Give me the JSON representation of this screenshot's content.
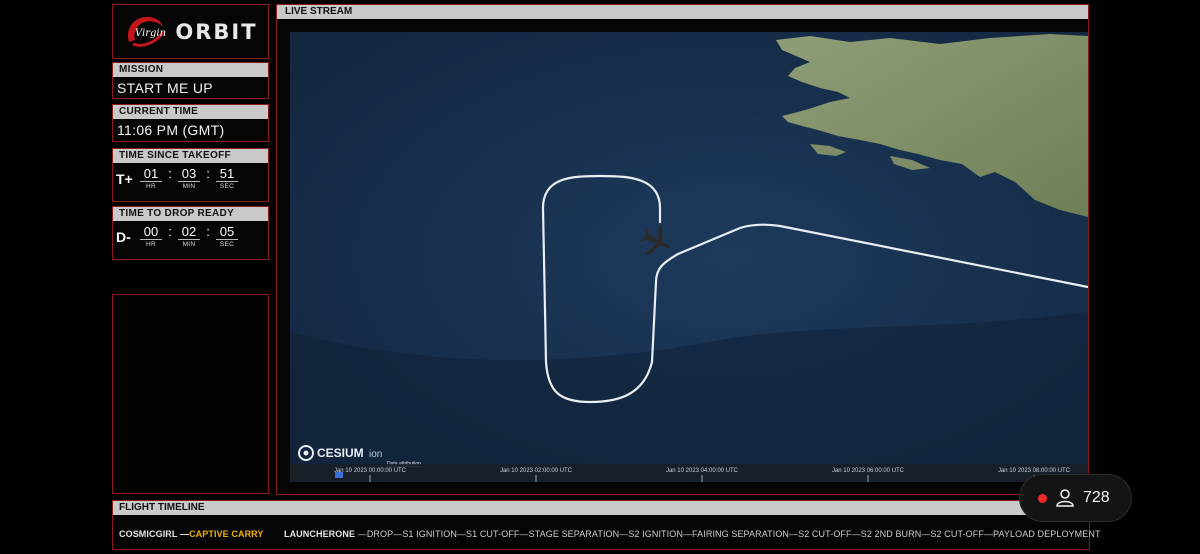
{
  "brand": {
    "logo_script": "Virgin",
    "logo_text": "ORBIT",
    "accent": "#c4161c"
  },
  "mission": {
    "label": "MISSION",
    "value": "START ME UP"
  },
  "current_time": {
    "label": "CURRENT TIME",
    "value": "11:06 PM (GMT)"
  },
  "time_since_takeoff": {
    "label": "TIME SINCE TAKEOFF",
    "prefix": "T+",
    "hr": "01",
    "min": "03",
    "sec": "51",
    "hr_label": "HR",
    "min_label": "MIN",
    "sec_label": "SEC"
  },
  "time_to_drop": {
    "label": "TIME TO DROP READY",
    "prefix": "D-",
    "hr": "00",
    "min": "02",
    "sec": "05",
    "hr_label": "HR",
    "min_label": "MIN",
    "sec_label": "SEC"
  },
  "live_stream": {
    "label": "LIVE STREAM",
    "attribution_logo": "CESIUM",
    "attribution_suffix": "ion",
    "attribution_link": "Data attribution",
    "timeline_ticks": [
      "Jan 10 2023 00:00:00 UTC",
      "Jan 10 2023 02:00:00 UTC",
      "Jan 10 2023 04:00:00 UTC",
      "Jan 10 2023 06:00:00 UTC",
      "Jan 10 2023 08:00:00 UTC"
    ]
  },
  "flight_timeline": {
    "label": "FLIGHT TIMELINE",
    "vehicle1": "COSMICGIRL",
    "phase_active": "CAPTIVE CARRY",
    "vehicle2": "LAUNCHERONE",
    "phases": "DROP—S1 IGNITION—S1 CUT-OFF—STAGE SEPARATION—S2 IGNITION—FAIRING SEPARATION—S2 CUT-OFF—S2 2ND BURN—S2 CUT-OFF—PAYLOAD DEPLOYMENT"
  },
  "viewers": {
    "count": "728",
    "icon": "person-icon"
  }
}
